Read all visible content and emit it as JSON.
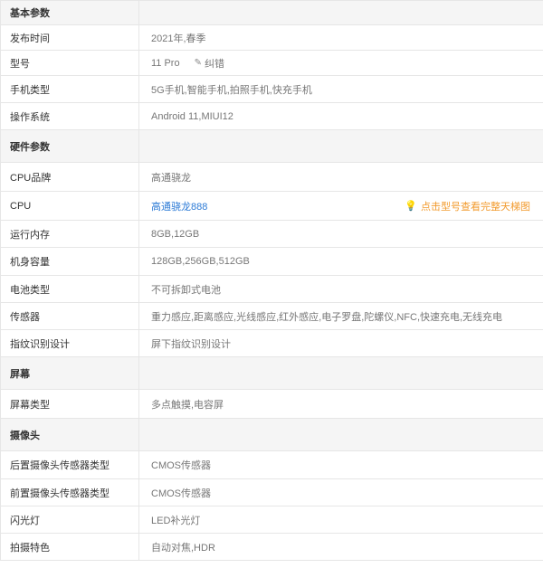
{
  "rows": [
    {
      "type": "section",
      "label": "基本参数"
    },
    {
      "type": "item",
      "label": "发布时间",
      "value": "2021年,春季"
    },
    {
      "type": "item-edit",
      "label": "型号",
      "value": "11 Pro",
      "edit_label": "纠错"
    },
    {
      "type": "item",
      "label": "手机类型",
      "value": "5G手机,智能手机,拍照手机,快充手机"
    },
    {
      "type": "item",
      "label": "操作系统",
      "value": "Android 11,MIUI12"
    },
    {
      "type": "section",
      "label": "硬件参数"
    },
    {
      "type": "item",
      "label": "CPU品牌",
      "value": "高通骁龙"
    },
    {
      "type": "item-link",
      "label": "CPU",
      "value": "高通骁龙888",
      "hint": "点击型号查看完整天梯图"
    },
    {
      "type": "item",
      "label": "运行内存",
      "value": "8GB,12GB"
    },
    {
      "type": "item",
      "label": "机身容量",
      "value": "128GB,256GB,512GB"
    },
    {
      "type": "item",
      "label": "电池类型",
      "value": "不可拆卸式电池"
    },
    {
      "type": "item",
      "label": "传感器",
      "value": "重力感应,距离感应,光线感应,红外感应,电子罗盘,陀螺仪,NFC,快速充电,无线充电"
    },
    {
      "type": "item",
      "label": "指纹识别设计",
      "value": "屏下指纹识别设计"
    },
    {
      "type": "section",
      "label": "屏幕"
    },
    {
      "type": "item",
      "label": "屏幕类型",
      "value": "多点触摸,电容屏"
    },
    {
      "type": "section",
      "label": "摄像头"
    },
    {
      "type": "item",
      "label": "后置摄像头传感器类型",
      "value": "CMOS传感器"
    },
    {
      "type": "item",
      "label": "前置摄像头传感器类型",
      "value": "CMOS传感器"
    },
    {
      "type": "item",
      "label": "闪光灯",
      "value": "LED补光灯"
    },
    {
      "type": "item",
      "label": "拍摄特色",
      "value": "自动对焦,HDR"
    }
  ],
  "icons": {
    "edit": "pencil-icon",
    "hint": "lightbulb-icon"
  },
  "colors": {
    "link": "#2d7bd6",
    "hint": "#f29b2e",
    "section_bg": "#f5f5f5",
    "border": "#e6e6e6"
  }
}
